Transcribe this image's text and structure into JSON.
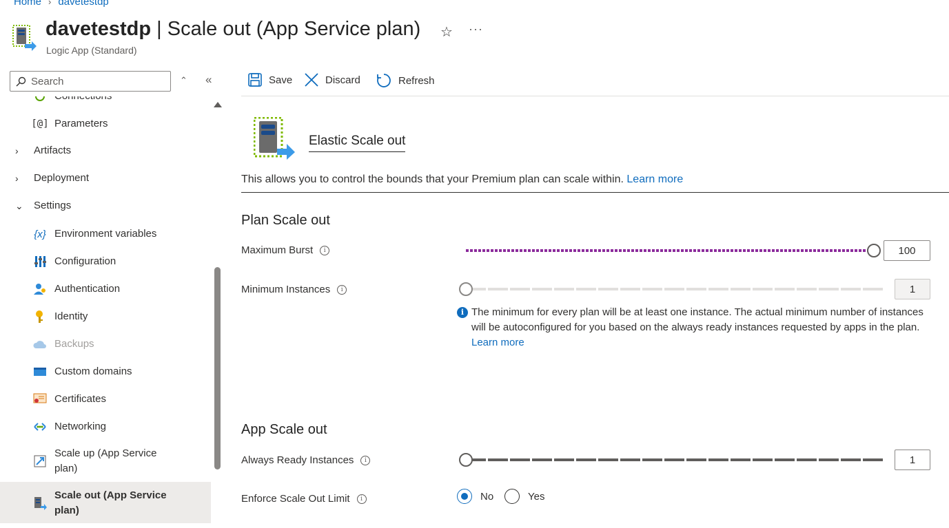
{
  "breadcrumb": {
    "home": "Home",
    "resource": "davetestdp"
  },
  "header": {
    "title_resource": "davetestdp",
    "title_sep": " | ",
    "title_page": "Scale out (App Service plan)",
    "subtitle": "Logic App (Standard)"
  },
  "sidebar": {
    "search_placeholder": "Search",
    "items": [
      {
        "label": "Connections",
        "icon": "connections-icon"
      },
      {
        "label": "Parameters",
        "icon": "parameters-icon"
      },
      {
        "label": "Artifacts",
        "type": "group",
        "expanded": false
      },
      {
        "label": "Deployment",
        "type": "group",
        "expanded": false
      },
      {
        "label": "Settings",
        "type": "group",
        "expanded": true
      },
      {
        "label": "Environment variables",
        "icon": "environment-variables-icon"
      },
      {
        "label": "Configuration",
        "icon": "configuration-icon"
      },
      {
        "label": "Authentication",
        "icon": "authentication-icon"
      },
      {
        "label": "Identity",
        "icon": "identity-icon"
      },
      {
        "label": "Backups",
        "icon": "backups-icon",
        "disabled": true
      },
      {
        "label": "Custom domains",
        "icon": "custom-domains-icon"
      },
      {
        "label": "Certificates",
        "icon": "certificates-icon"
      },
      {
        "label": "Networking",
        "icon": "networking-icon"
      },
      {
        "label": "Scale up (App Service plan)",
        "icon": "scale-up-icon"
      },
      {
        "label": "Scale out (App Service plan)",
        "icon": "scale-out-icon",
        "selected": true
      }
    ]
  },
  "toolbar": {
    "save": "Save",
    "discard": "Discard",
    "refresh": "Refresh"
  },
  "main": {
    "hero_title": "Elastic Scale out",
    "description": "This allows you to control the bounds that your Premium plan can scale within.",
    "learn_more": "Learn more",
    "plan_section": {
      "heading": "Plan Scale out",
      "maximum_burst": {
        "label": "Maximum Burst",
        "value": "100",
        "fraction": 1.0
      },
      "minimum_instances": {
        "label": "Minimum Instances",
        "value": "1",
        "fraction": 0.0,
        "disabled": true
      },
      "info_text": "The minimum for every plan will be at least one instance. The actual minimum number of instances will be autoconfigured for you based on the always ready instances requested by apps in the plan.",
      "info_link": "Learn more"
    },
    "app_section": {
      "heading": "App Scale out",
      "always_ready": {
        "label": "Always Ready Instances",
        "value": "1",
        "fraction": 0.0
      },
      "enforce_limit": {
        "label": "Enforce Scale Out Limit",
        "options": [
          "No",
          "Yes"
        ],
        "selected": "No"
      }
    }
  },
  "colors": {
    "accent": "#0f6cbd",
    "burst_slider": "#8c2b9c",
    "selected_nav": "#edebe9"
  }
}
